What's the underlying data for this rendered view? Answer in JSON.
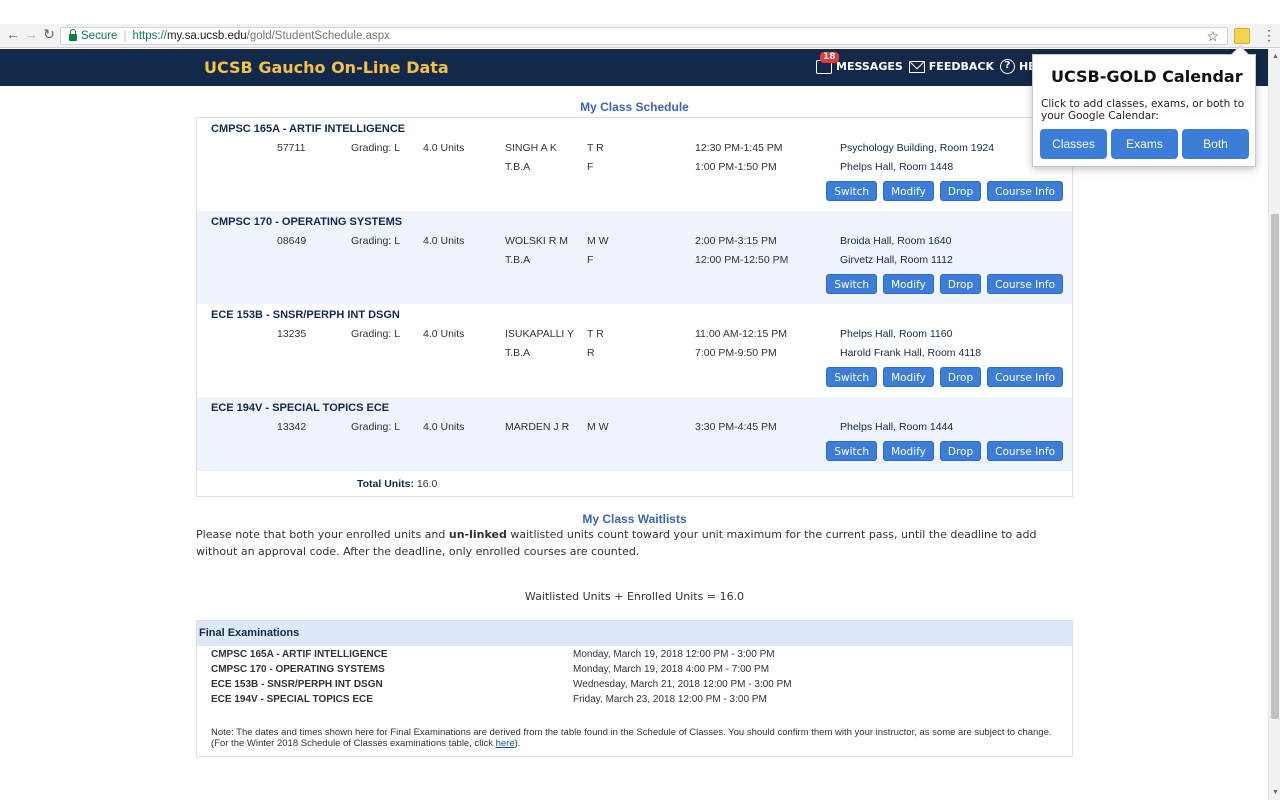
{
  "browser": {
    "back_icon": "back-arrow-icon",
    "secure_label": "Secure",
    "url_scheme": "https://",
    "url_host": "my.sa.ucsb.edu",
    "url_path": "/gold/StudentSchedule.aspx"
  },
  "header": {
    "site_title": "UCSB Gaucho On-Line Data",
    "messages_count": "18",
    "messages_label": "MESSAGES",
    "feedback_label": "FEEDBACK",
    "help_label": "HELP"
  },
  "schedule": {
    "title": "My Class Schedule",
    "courses": [
      {
        "title": "CMPSC 165A - ARTIF INTELLIGENCE",
        "code": "57711",
        "grading": "Grading: L",
        "units": "4.0 Units",
        "rows": [
          {
            "instructor": "SINGH A K",
            "days": "T R",
            "time": "12:30 PM-1:45 PM",
            "location": "Psychology Building, Room 1924"
          },
          {
            "instructor": "T.B.A",
            "days": "F",
            "time": "1:00 PM-1:50 PM",
            "location": "Phelps Hall, Room 1448"
          }
        ]
      },
      {
        "title": "CMPSC 170 - OPERATING SYSTEMS",
        "code": "08649",
        "grading": "Grading: L",
        "units": "4.0 Units",
        "rows": [
          {
            "instructor": "WOLSKI R M",
            "days": "M W",
            "time": "2:00 PM-3:15 PM",
            "location": "Broida Hall, Room 1640"
          },
          {
            "instructor": "T.B.A",
            "days": "F",
            "time": "12:00 PM-12:50 PM",
            "location": "Girvetz Hall, Room 1112"
          }
        ]
      },
      {
        "title": "ECE 153B - SNSR/PERPH INT DSGN",
        "code": "13235",
        "grading": "Grading: L",
        "units": "4.0 Units",
        "rows": [
          {
            "instructor": "ISUKAPALLI Y",
            "days": "T R",
            "time": "11:00 AM-12:15 PM",
            "location": "Phelps Hall, Room 1160"
          },
          {
            "instructor": "T.B.A",
            "days": "R",
            "time": "7:00 PM-9:50 PM",
            "location": "Harold Frank Hall, Room 4118"
          }
        ]
      },
      {
        "title": "ECE 194V - SPECIAL TOPICS ECE",
        "code": "13342",
        "grading": "Grading: L",
        "units": "4.0 Units",
        "rows": [
          {
            "instructor": "MARDEN J R",
            "days": "M W",
            "time": "3:30 PM-4:45 PM",
            "location": "Phelps Hall, Room 1444"
          }
        ]
      }
    ],
    "buttons": {
      "switch": "Switch",
      "modify": "Modify",
      "drop": "Drop",
      "info": "Course Info"
    },
    "total_label": "Total Units:",
    "total_value": "16.0"
  },
  "waitlist": {
    "title": "My Class Waitlists",
    "note_pre": "Please note that both your enrolled units and ",
    "note_bold": "un-linked",
    "note_post": " waitlisted units count toward your unit maximum for the current pass, until the deadline to add without an approval code. After the deadline, only enrolled courses are counted.",
    "units_line": "Waitlisted Units + Enrolled Units = 16.0"
  },
  "exams": {
    "title": "Final Examinations",
    "items": [
      {
        "course": "CMPSC 165A - ARTIF INTELLIGENCE",
        "time": "Monday, March 19, 2018 12:00 PM - 3:00 PM"
      },
      {
        "course": "CMPSC 170 - OPERATING SYSTEMS",
        "time": "Monday, March 19, 2018 4:00 PM - 7:00 PM"
      },
      {
        "course": "ECE 153B - SNSR/PERPH INT DSGN",
        "time": "Wednesday, March 21, 2018 12:00 PM - 3:00 PM"
      },
      {
        "course": "ECE 194V - SPECIAL TOPICS ECE",
        "time": "Friday, March 23, 2018 12:00 PM - 3:00 PM"
      }
    ],
    "note_pre": "Note: The dates and times shown here for Final Examinations are derived from the table found in the Schedule of Classes. You should confirm them with your instructor, as some are subject to change. (For the Winter 2018 Schedule of Classes examinations table, click ",
    "note_link": "here",
    "note_post": ")."
  },
  "popup": {
    "title": "UCSB-GOLD Calendar",
    "description": "Click to add classes, exams, or both to your Google Calendar:",
    "buttons": [
      "Classes",
      "Exams",
      "Both"
    ]
  }
}
